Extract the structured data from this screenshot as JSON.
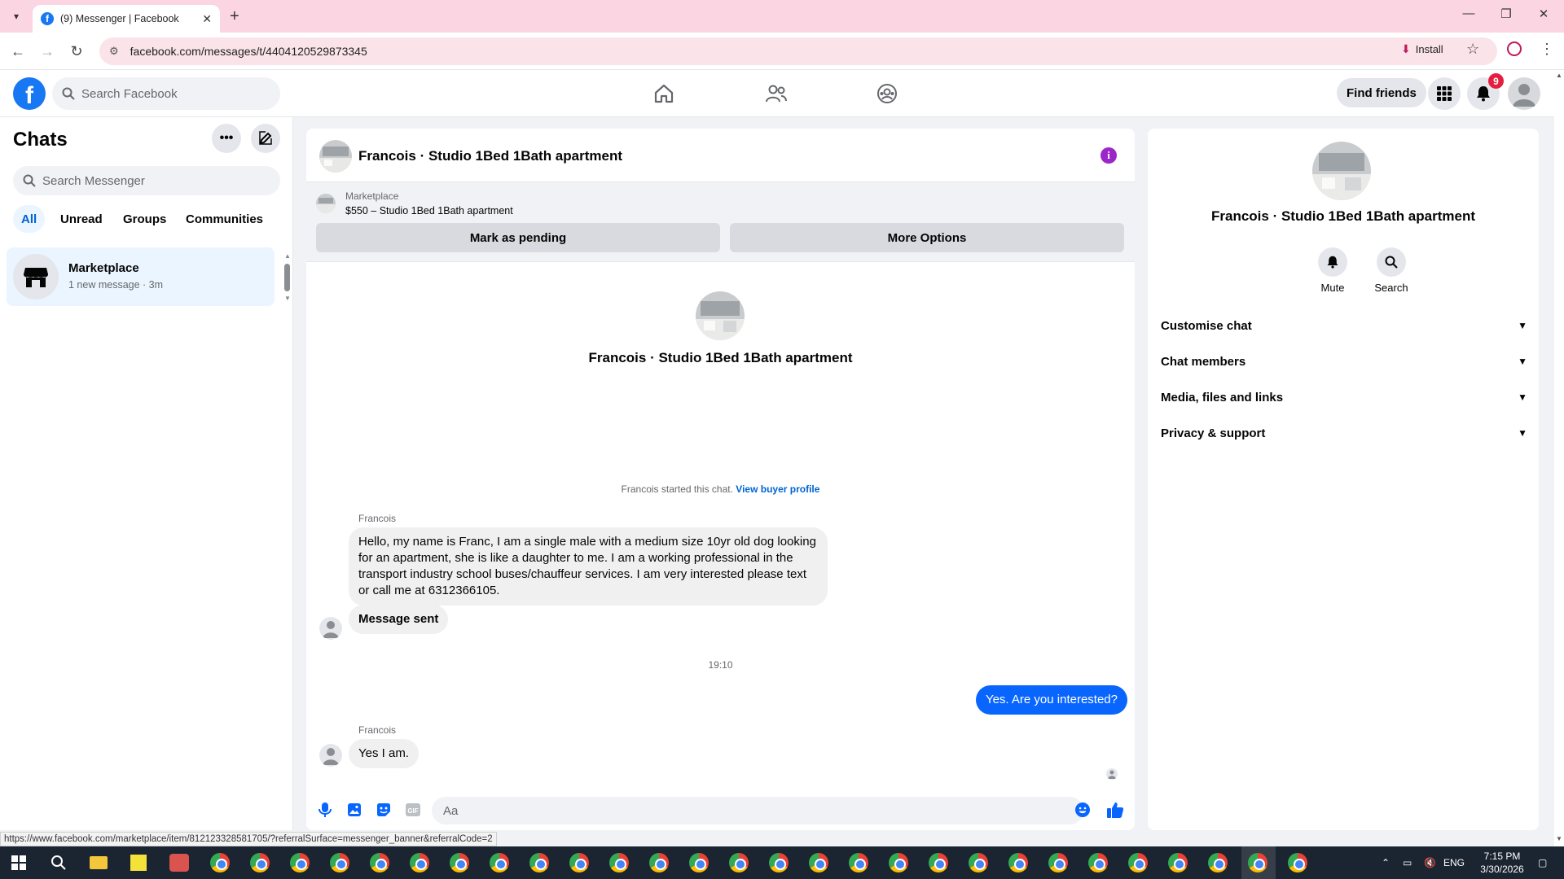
{
  "browser": {
    "tab_title": "(9) Messenger | Facebook",
    "url": "facebook.com/messages/t/4404120529873345",
    "install_label": "Install",
    "status_url": "https://www.facebook.com/marketplace/item/812123328581705/?referralSurface=messenger_banner&referralCode=2"
  },
  "header": {
    "search_placeholder": "Search Facebook",
    "find_friends": "Find friends",
    "notification_count": "9",
    "brand_color": "#1877f2"
  },
  "sidebar": {
    "title": "Chats",
    "search_placeholder": "Search Messenger",
    "filters": [
      "All",
      "Unread",
      "Groups",
      "Communities"
    ],
    "active_filter": "All",
    "chats": [
      {
        "name": "Marketplace",
        "preview": "1 new message",
        "time": "3m"
      }
    ]
  },
  "conversation": {
    "title": "Francois · Studio 1Bed 1Bath apartment",
    "banner_label": "Marketplace",
    "listing": "$550 – Studio 1Bed 1Bath apartment",
    "mark_pending": "Mark as pending",
    "more_options": "More Options",
    "started_text": "Francois started this chat.",
    "view_buyer_profile": "View buyer profile",
    "messages": [
      {
        "sender": "Francois",
        "text": "Hello, my name is Franc, I am a single male with a medium size 10yr old dog looking for an apartment, she is like a daughter to me. I am a working professional in the transport industry school buses/chauffeur services. I am very interested please text or call me at 6312366105."
      },
      {
        "text": "Message sent"
      },
      {
        "timestamp": "19:10"
      },
      {
        "text": "Yes. Are you interested?"
      },
      {
        "sender": "Francois",
        "text": "Yes I am."
      }
    ],
    "composer_placeholder": "Aa",
    "outgoing_color": "#0866ff"
  },
  "info_panel": {
    "name": "Francois · Studio 1Bed 1Bath apartment",
    "actions": [
      "Mute",
      "Search"
    ],
    "sections": [
      "Customise chat",
      "Chat members",
      "Media, files and links",
      "Privacy & support"
    ]
  },
  "taskbar": {
    "language": "ENG",
    "time": "7:15 PM",
    "date": "3/30/2026"
  }
}
